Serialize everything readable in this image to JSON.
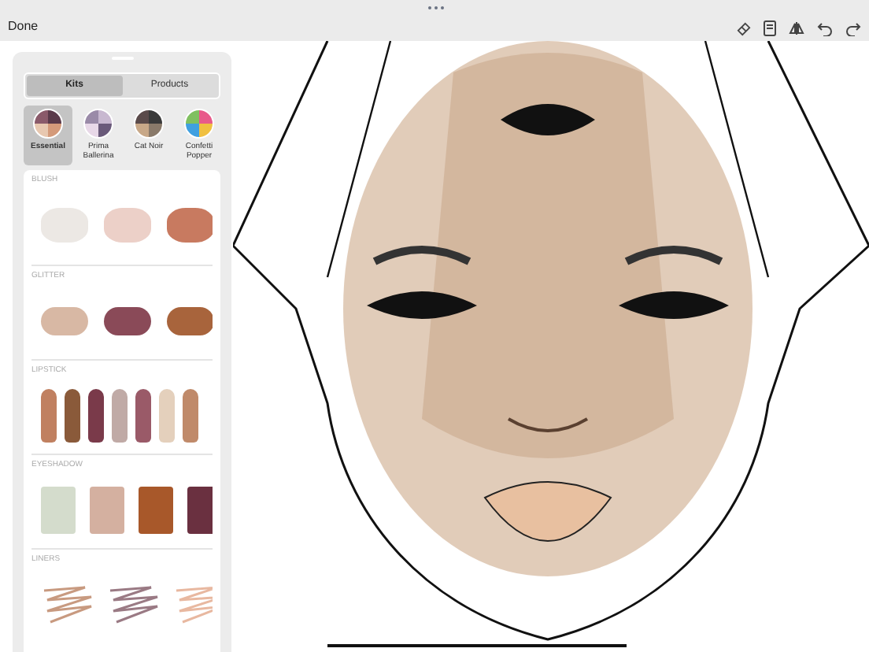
{
  "top_bar": {
    "done_label": "Done"
  },
  "panel": {
    "tabs": [
      {
        "label": "Kits",
        "selected": true
      },
      {
        "label": "Products",
        "selected": false
      }
    ],
    "kits": [
      {
        "name": "Essential",
        "selected": true
      },
      {
        "name": "Prima Ballerina",
        "selected": false
      },
      {
        "name": "Cat Noir",
        "selected": false
      },
      {
        "name": "Confetti Popper",
        "selected": false
      }
    ],
    "sections": [
      {
        "title": "BLUSH",
        "kind": "powder",
        "swatches": [
          {
            "color": "#ece8e4"
          },
          {
            "color": "#ecd0c8"
          },
          {
            "color": "#c87a60"
          }
        ]
      },
      {
        "title": "GLITTER",
        "kind": "glitter",
        "swatches": [
          {
            "color": "#d8b8a4"
          },
          {
            "color": "#8a4a58"
          },
          {
            "color": "#a8643c"
          }
        ]
      },
      {
        "title": "LIPSTICK",
        "kind": "lipstick",
        "swatches": [
          {
            "color": "#c08060"
          },
          {
            "color": "#8a5a3a"
          },
          {
            "color": "#7a3a4a"
          },
          {
            "color": "#c0aaa6"
          },
          {
            "color": "#9a5a68"
          },
          {
            "color": "#e4d0bc"
          },
          {
            "color": "#c08a6a"
          }
        ]
      },
      {
        "title": "EYESHADOW",
        "kind": "eyeshadow",
        "swatches": [
          {
            "color": "#d4dccc"
          },
          {
            "color": "#d4b0a0"
          },
          {
            "color": "#a8582a"
          },
          {
            "color": "#6a3040"
          }
        ]
      },
      {
        "title": "LINERS",
        "kind": "liner",
        "swatches": [
          {
            "color": "#c89a80"
          },
          {
            "color": "#9a7a84"
          },
          {
            "color": "#e8b8a0"
          }
        ]
      }
    ]
  }
}
